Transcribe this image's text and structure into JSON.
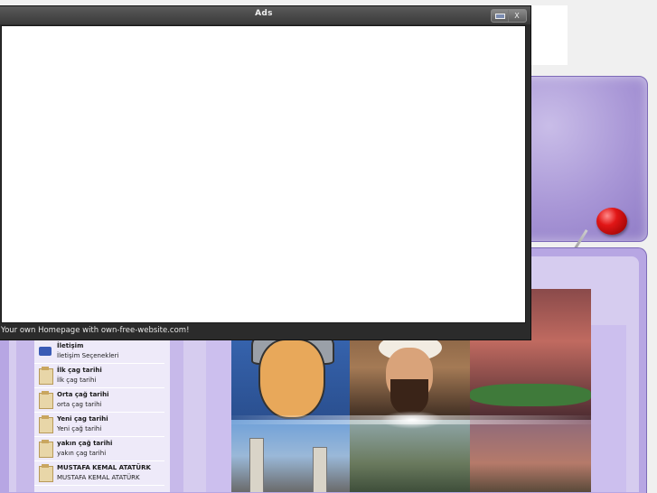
{
  "ads_window": {
    "title": "Ads",
    "status_text": "Your own Homepage with own-free-website.com!",
    "minimize_icon": "minimize-icon",
    "close_label": "X"
  },
  "menu": {
    "items": [
      {
        "title": "İletişim",
        "subtitle": "İletişim Seçenekleri",
        "icon": "computer-icon"
      },
      {
        "title": "İlk çag tarihi",
        "subtitle": "İlk çag tarihi",
        "icon": "folder-icon"
      },
      {
        "title": "Orta çağ tarihi",
        "subtitle": "orta çag tarihi",
        "icon": "folder-icon"
      },
      {
        "title": "Yeni çag tarihi",
        "subtitle": "Yeni çağ tarihi",
        "icon": "folder-icon"
      },
      {
        "title": "yakın çağ tarihi",
        "subtitle": "yakın çag tarihi",
        "icon": "folder-icon"
      },
      {
        "title": "MUSTAFA KEMAL ATATÜRK",
        "subtitle": "MUSTAFA KEMAL ATATÜRK",
        "icon": "folder-icon"
      }
    ]
  },
  "colors": {
    "panel_purple": "#b7a6e3",
    "pin_red": "#e11616",
    "window_dark": "#2b2b2b"
  }
}
